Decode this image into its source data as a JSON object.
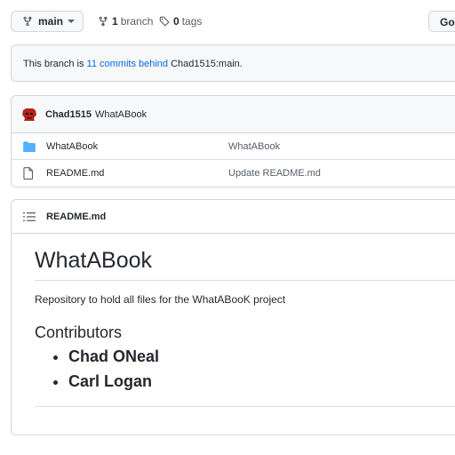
{
  "toolbar": {
    "branch_name": "main",
    "branch_count": "1",
    "branch_word": "branch",
    "tag_count": "0",
    "tag_word": "tags",
    "go_label": "Go"
  },
  "notice": {
    "prefix": "This branch is ",
    "link": "11 commits behind",
    "suffix": " Chad1515:main."
  },
  "latest_commit": {
    "author": "Chad1515",
    "message": "WhatABook"
  },
  "files": [
    {
      "type": "folder",
      "name": "WhatABook",
      "commit_message": "WhatABook"
    },
    {
      "type": "file",
      "name": "README.md",
      "commit_message": "Update README.md"
    }
  ],
  "readme": {
    "filename": "README.md",
    "title": "WhatABook",
    "description": "Repository to hold all files for the WhatABooK project",
    "section_heading": "Contributors",
    "contributors": [
      "Chad ONeal",
      "Carl Logan"
    ]
  },
  "colors": {
    "link": "#0969da",
    "folder": "#54aeff",
    "border": "#d0d7de",
    "header_bg": "#f6f8fa"
  }
}
